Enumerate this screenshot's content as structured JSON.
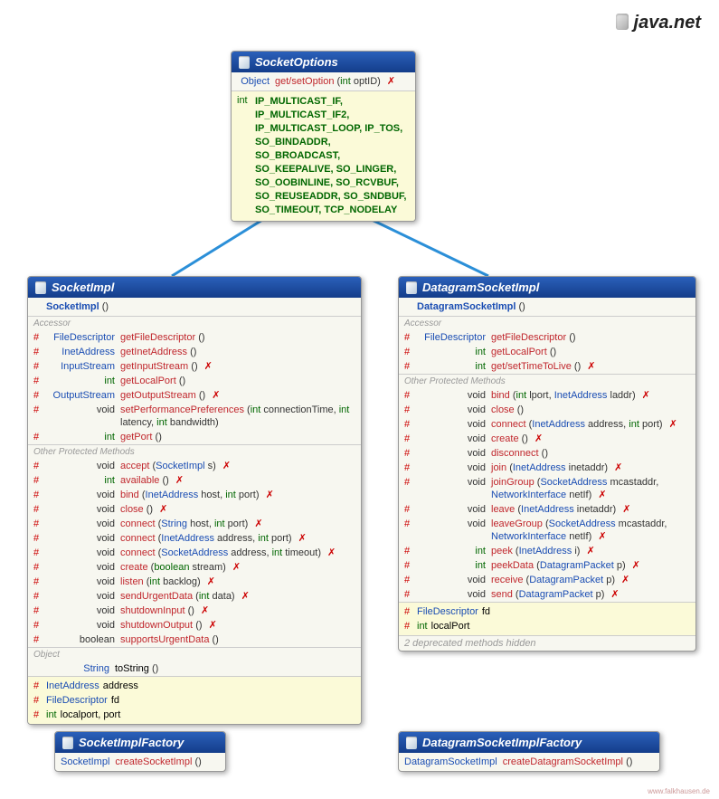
{
  "package": "java.net",
  "footer": "www.falkhausen.de",
  "socketOptions": {
    "title": "SocketOptions",
    "methodRow": {
      "retType": "Object",
      "name": "get/setOption",
      "params": "(int optID)"
    },
    "constantsType": "int",
    "constants": "IP_MULTICAST_IF, IP_MULTICAST_IF2, IP_MULTICAST_LOOP, IP_TOS, SO_BINDADDR, SO_BROADCAST, SO_KEEPALIVE, SO_LINGER, SO_OOBINLINE, SO_RCVBUF, SO_REUSEADDR, SO_SNDBUF, SO_TIMEOUT, TCP_NODELAY"
  },
  "socketImpl": {
    "title": "SocketImpl",
    "ctor": "SocketImpl",
    "accessorLabel": "Accessor",
    "otherLabel": "Other Protected Methods",
    "objectLabel": "Object",
    "accessors": [
      {
        "vis": "#",
        "ret": "FileDescriptor",
        "retc": "type-file",
        "name": "getFileDescriptor",
        "params": "()"
      },
      {
        "vis": "#",
        "ret": "InetAddress",
        "retc": "type-inet",
        "name": "getInetAddress",
        "params": "()"
      },
      {
        "vis": "#",
        "ret": "InputStream",
        "retc": "type-is",
        "name": "getInputStream",
        "params": "()",
        "throws": true
      },
      {
        "vis": "#",
        "ret": "int",
        "retc": "ret-int",
        "name": "getLocalPort",
        "params": "()"
      },
      {
        "vis": "#",
        "ret": "OutputStream",
        "retc": "type-os",
        "name": "getOutputStream",
        "params": "()",
        "throws": true
      },
      {
        "vis": "#",
        "ret": "void",
        "retc": "ret-void",
        "name": "setPerformancePreferences",
        "paramsHtml": "(<span class='param-kw'>int</span> connectionTime, <span class='param-kw'>int</span> latency, <span class='param-kw'>int</span> bandwidth)"
      },
      {
        "vis": "#",
        "ret": "int",
        "retc": "ret-int",
        "name": "getPort",
        "params": "()"
      }
    ],
    "others": [
      {
        "vis": "#",
        "ret": "void",
        "name": "accept",
        "paramsHtml": "(<span class='param-type'>SocketImpl</span> s)",
        "throws": true
      },
      {
        "vis": "#",
        "ret": "int",
        "retc": "ret-int",
        "name": "available",
        "params": "()",
        "throws": true
      },
      {
        "vis": "#",
        "ret": "void",
        "name": "bind",
        "paramsHtml": "(<span class='param-type'>InetAddress</span> host, <span class='param-kw'>int</span> port)",
        "throws": true
      },
      {
        "vis": "#",
        "ret": "void",
        "name": "close",
        "params": "()",
        "throws": true
      },
      {
        "vis": "#",
        "ret": "void",
        "name": "connect",
        "paramsHtml": "(<span class='param-type'>String</span> host, <span class='param-kw'>int</span> port)",
        "throws": true
      },
      {
        "vis": "#",
        "ret": "void",
        "name": "connect",
        "paramsHtml": "(<span class='param-type'>InetAddress</span> address, <span class='param-kw'>int</span> port)",
        "throws": true
      },
      {
        "vis": "#",
        "ret": "void",
        "name": "connect",
        "paramsHtml": "(<span class='param-type'>SocketAddress</span> address, <span class='param-kw'>int</span> timeout)",
        "throws": true
      },
      {
        "vis": "#",
        "ret": "void",
        "name": "create",
        "paramsHtml": "(<span class='param-kw'>boolean</span> stream)",
        "throws": true
      },
      {
        "vis": "#",
        "ret": "void",
        "name": "listen",
        "paramsHtml": "(<span class='param-kw'>int</span> backlog)",
        "throws": true
      },
      {
        "vis": "#",
        "ret": "void",
        "name": "sendUrgentData",
        "paramsHtml": "(<span class='param-kw'>int</span> data)",
        "throws": true
      },
      {
        "vis": "#",
        "ret": "void",
        "name": "shutdownInput",
        "params": "()",
        "throws": true
      },
      {
        "vis": "#",
        "ret": "void",
        "name": "shutdownOutput",
        "params": "()",
        "throws": true
      },
      {
        "vis": "#",
        "ret": "boolean",
        "retc": "ret-bool",
        "name": "supportsUrgentData",
        "params": "()"
      }
    ],
    "obj": {
      "ret": "String",
      "name": "toString",
      "params": "()"
    },
    "fields": [
      {
        "vis": "#",
        "type": "InetAddress",
        "tc": "ftype",
        "name": "address"
      },
      {
        "vis": "#",
        "type": "FileDescriptor",
        "tc": "ftype",
        "name": "fd"
      },
      {
        "vis": "#",
        "type": "int",
        "tc": "fint",
        "name": "localport, port"
      }
    ]
  },
  "datagramSocketImpl": {
    "title": "DatagramSocketImpl",
    "ctor": "DatagramSocketImpl",
    "accessorLabel": "Accessor",
    "otherLabel": "Other Protected Methods",
    "accessors": [
      {
        "vis": "#",
        "ret": "FileDescriptor",
        "retc": "type-file",
        "name": "getFileDescriptor",
        "params": "()"
      },
      {
        "vis": "#",
        "ret": "int",
        "retc": "ret-int",
        "name": "getLocalPort",
        "params": "()"
      },
      {
        "vis": "#",
        "ret": "int",
        "retc": "ret-int",
        "name": "get/setTimeToLive",
        "params": "()",
        "throws": true
      }
    ],
    "others": [
      {
        "vis": "#",
        "ret": "void",
        "name": "bind",
        "paramsHtml": "(<span class='param-kw'>int</span> lport, <span class='param-type'>InetAddress</span> laddr)",
        "throws": true
      },
      {
        "vis": "#",
        "ret": "void",
        "name": "close",
        "params": "()"
      },
      {
        "vis": "#",
        "ret": "void",
        "name": "connect",
        "paramsHtml": "(<span class='param-type'>InetAddress</span> address, <span class='param-kw'>int</span> port)",
        "throws": true
      },
      {
        "vis": "#",
        "ret": "void",
        "name": "create",
        "params": "()",
        "throws": true
      },
      {
        "vis": "#",
        "ret": "void",
        "name": "disconnect",
        "params": "()"
      },
      {
        "vis": "#",
        "ret": "void",
        "name": "join",
        "paramsHtml": "(<span class='param-type'>InetAddress</span> inetaddr)",
        "throws": true
      },
      {
        "vis": "#",
        "ret": "void",
        "name": "joinGroup",
        "paramsHtml": "(<span class='param-type'>SocketAddress</span> mcastaddr, <span class='param-type'>NetworkInterface</span> netIf)",
        "throws": true
      },
      {
        "vis": "#",
        "ret": "void",
        "name": "leave",
        "paramsHtml": "(<span class='param-type'>InetAddress</span> inetaddr)",
        "throws": true
      },
      {
        "vis": "#",
        "ret": "void",
        "name": "leaveGroup",
        "paramsHtml": "(<span class='param-type'>SocketAddress</span> mcastaddr, <span class='param-type'>NetworkInterface</span> netIf)",
        "throws": true
      },
      {
        "vis": "#",
        "ret": "int",
        "retc": "ret-int",
        "name": "peek",
        "paramsHtml": "(<span class='param-type'>InetAddress</span> i)",
        "throws": true
      },
      {
        "vis": "#",
        "ret": "int",
        "retc": "ret-int",
        "name": "peekData",
        "paramsHtml": "(<span class='param-type'>DatagramPacket</span> p)",
        "throws": true
      },
      {
        "vis": "#",
        "ret": "void",
        "name": "receive",
        "paramsHtml": "(<span class='param-type'>DatagramPacket</span> p)",
        "throws": true
      },
      {
        "vis": "#",
        "ret": "void",
        "name": "send",
        "paramsHtml": "(<span class='param-type'>DatagramPacket</span> p)",
        "throws": true
      }
    ],
    "fields": [
      {
        "vis": "#",
        "type": "FileDescriptor",
        "tc": "ftype",
        "name": "fd"
      },
      {
        "vis": "#",
        "type": "int",
        "tc": "fint",
        "name": "localPort"
      }
    ],
    "note": "2 deprecated methods hidden"
  },
  "socketImplFactory": {
    "title": "SocketImplFactory",
    "method": {
      "ret": "SocketImpl",
      "name": "createSocketImpl",
      "params": "()"
    }
  },
  "datagramSocketImplFactory": {
    "title": "DatagramSocketImplFactory",
    "method": {
      "ret": "DatagramSocketImpl",
      "name": "createDatagramSocketImpl",
      "params": "()"
    }
  }
}
